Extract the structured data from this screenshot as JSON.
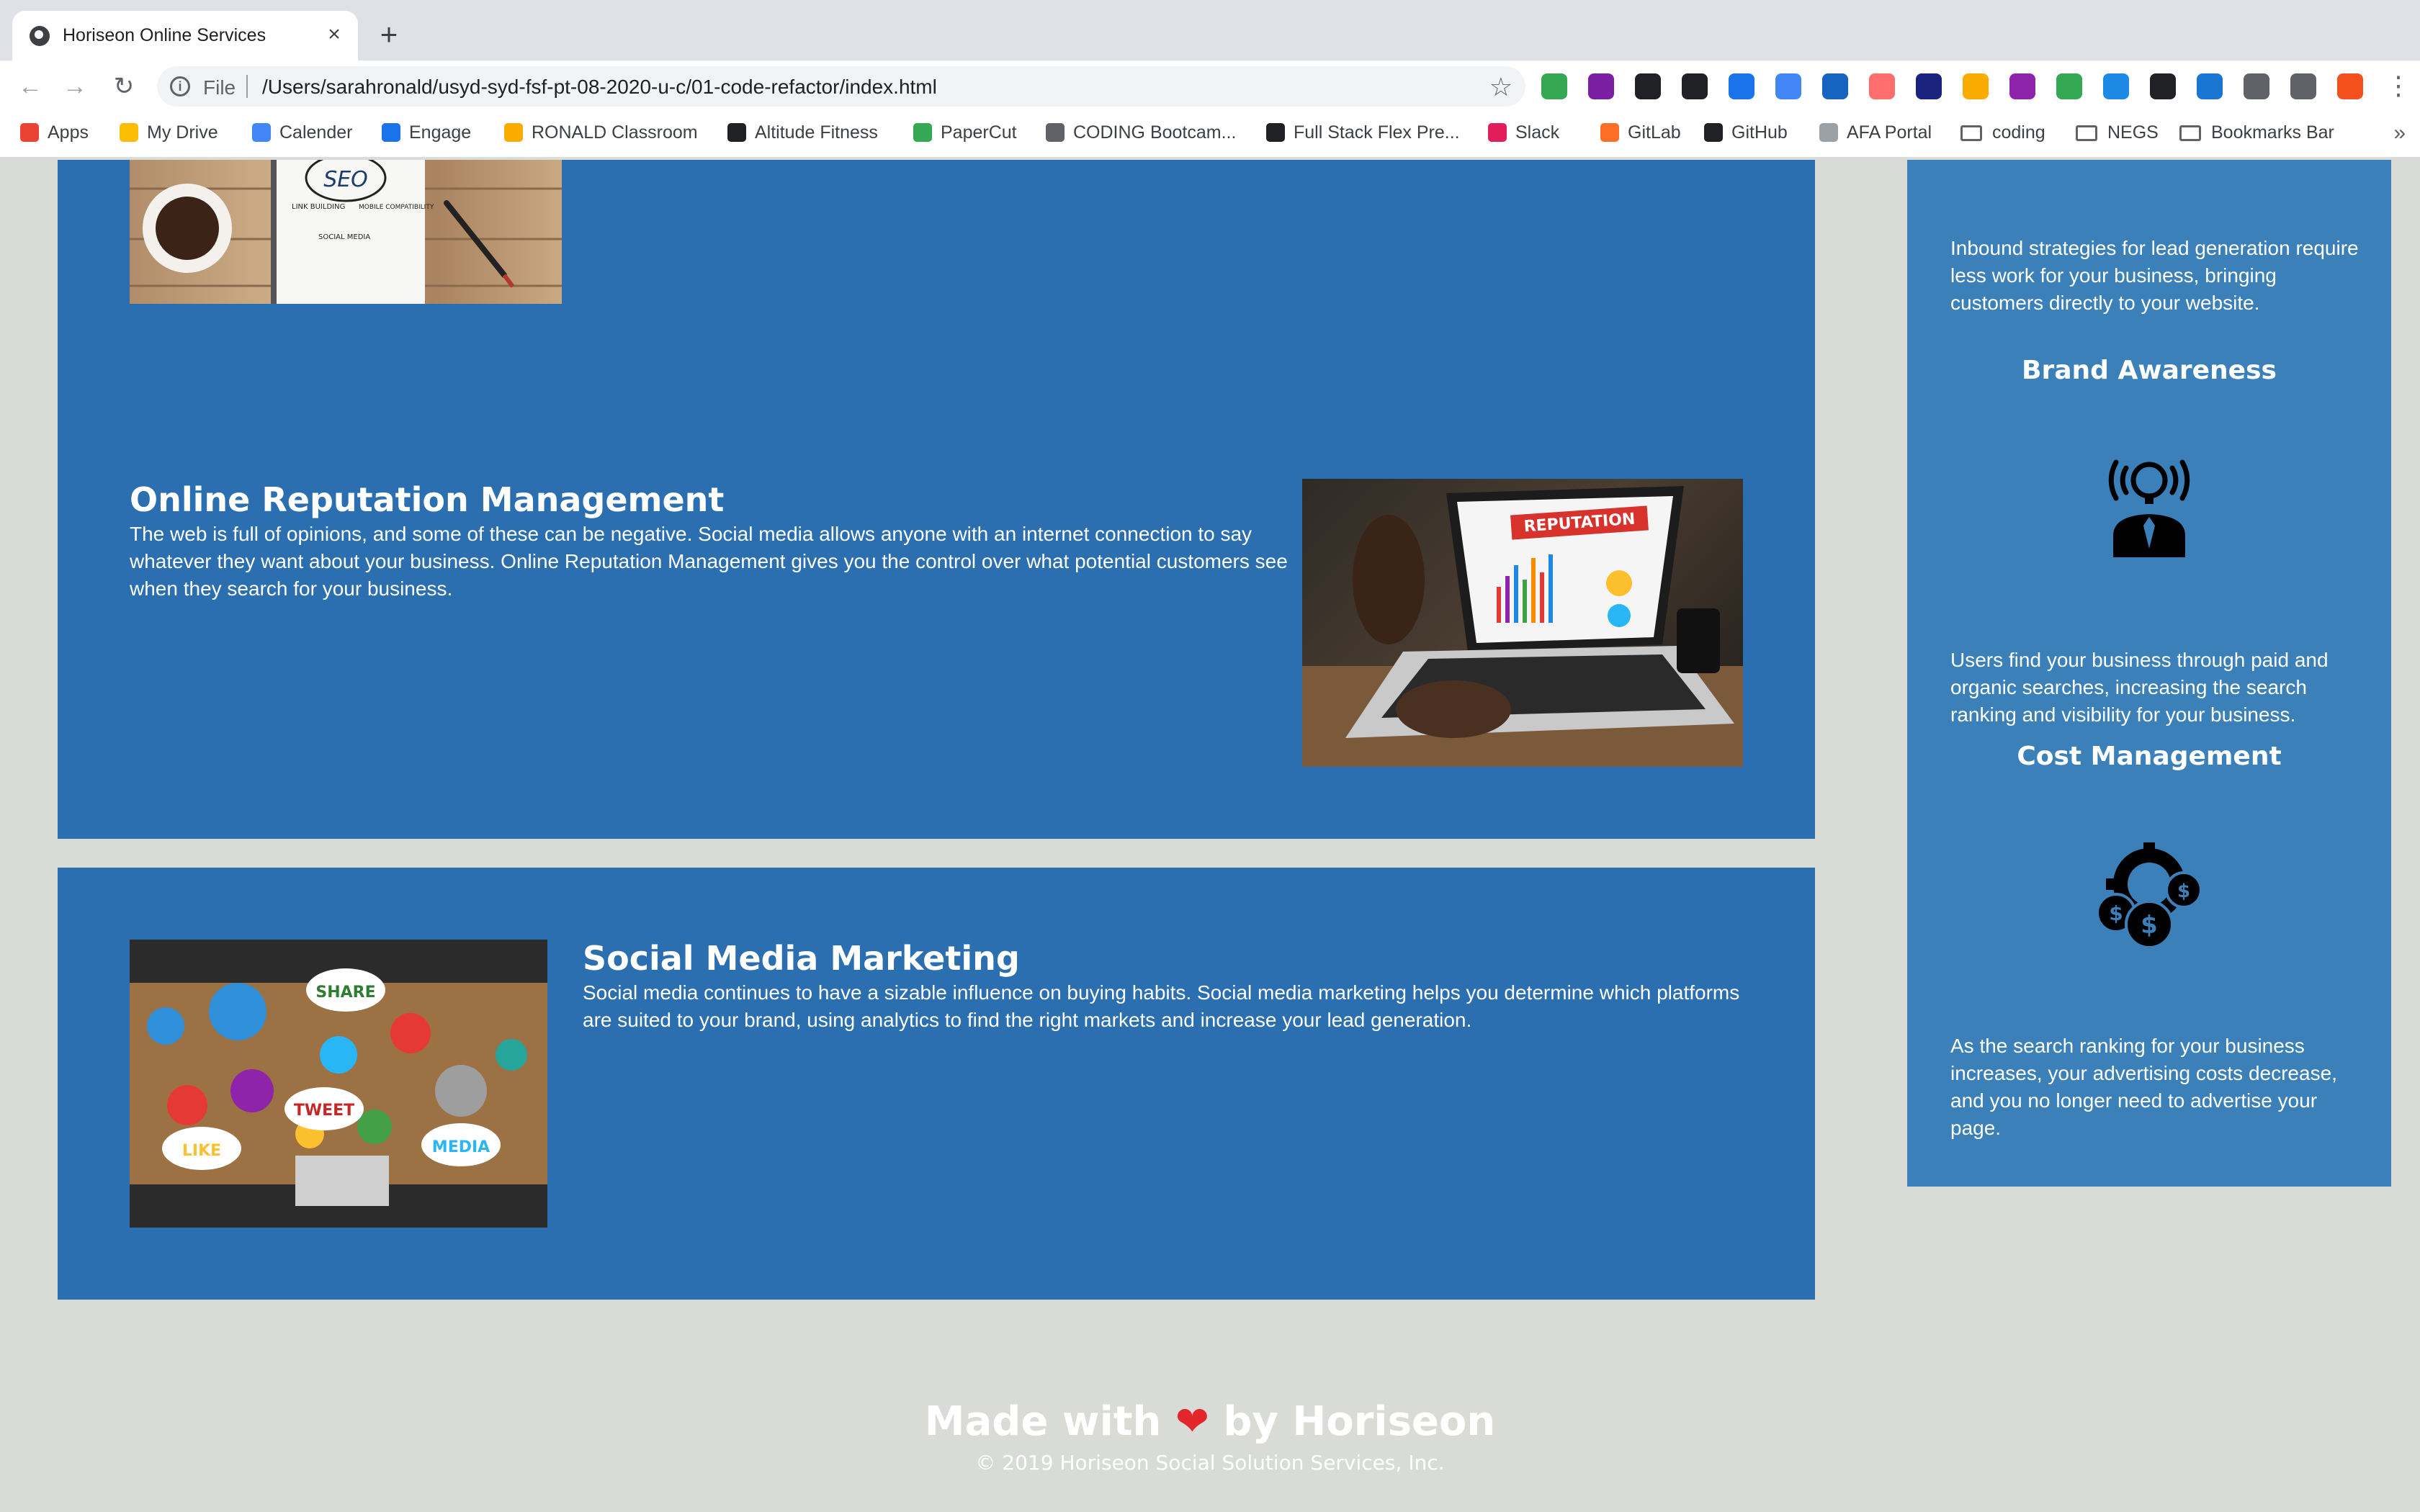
{
  "browser": {
    "tab_title": "Horiseon Online Services",
    "tab_close": "×",
    "new_tab": "+",
    "back": "←",
    "forward": "→",
    "reload": "↻",
    "info_glyph": "i",
    "scheme": "File",
    "url": "/Users/sarahronald/usyd-syd-fsf-pt-08-2020-u-c/01-code-refactor/index.html",
    "star": "☆",
    "menu": "⋮"
  },
  "bookmarks": {
    "items": [
      {
        "label": "Apps",
        "icon": "apps-grid-icon",
        "color": "#ea4335"
      },
      {
        "label": "My Drive",
        "icon": "google-drive-icon",
        "color": "#fbbc04"
      },
      {
        "label": "Calender",
        "icon": "calendar-icon",
        "color": "#4285f4"
      },
      {
        "label": "Engage",
        "icon": "butterfly-icon",
        "color": "#1a73e8"
      },
      {
        "label": "RONALD Classroom",
        "icon": "classroom-icon",
        "color": "#f9ab00"
      },
      {
        "label": "Altitude Fitness",
        "icon": "altitude-icon",
        "color": "#202124"
      },
      {
        "label": "PaperCut",
        "icon": "papercut-icon",
        "color": "#34a853"
      },
      {
        "label": "CODING Bootcam...",
        "icon": "globe-icon",
        "color": "#5f6368"
      },
      {
        "label": "Full Stack Flex Pre...",
        "icon": "book-icon",
        "color": "#202124"
      },
      {
        "label": "Slack",
        "icon": "slack-icon",
        "color": "#e01e5a"
      },
      {
        "label": "GitLab",
        "icon": "gitlab-icon",
        "color": "#fc6d26"
      },
      {
        "label": "GitHub",
        "icon": "github-icon",
        "color": "#202124"
      },
      {
        "label": "AFA Portal",
        "icon": "afa-icon",
        "color": "#9aa0a6"
      },
      {
        "label": "coding",
        "icon": "folder-icon",
        "color": "#5f6368"
      },
      {
        "label": "NEGS",
        "icon": "folder-icon",
        "color": "#5f6368"
      },
      {
        "label": "Bookmarks Bar",
        "icon": "folder-icon",
        "color": "#5f6368"
      }
    ],
    "more": "»"
  },
  "extensions": [
    "#34a853",
    "#7b1fa2",
    "#202124",
    "#202124",
    "#1a73e8",
    "#4285f4",
    "#1565c0",
    "#ff6d6d",
    "#1a237e",
    "#f9ab00",
    "#8e24aa",
    "#34a853",
    "#1e88e5",
    "#202124",
    "#1976d2",
    "#5f6368",
    "#5f6368",
    "#f4511e"
  ],
  "content": {
    "reputation": {
      "heading": "Online Reputation Management",
      "body": "The web is full of opinions, and some of these can be negative. Social media allows anyone with an internet connection to say whatever they want about your business. Online Reputation Management gives you the control over what potential customers see when they search for your business.",
      "image_label": "REPUTATION"
    },
    "social": {
      "heading": "Social Media Marketing",
      "body": "Social media continues to have a sizable influence on buying habits. Social media marketing helps you determine which platforms are suited to your brand, using analytics to find the right markets and increase your lead generation.",
      "bubbles": [
        "SHARE",
        "TWEET",
        "LIKE",
        "MEDIA"
      ]
    },
    "seo_image_text": [
      "SEO",
      "LINK BUILDING",
      "MOBILE COMPATIBILITY",
      "SOCIAL MEDIA"
    ]
  },
  "sidebar": {
    "lead_text": "Inbound strategies for lead generation require less work for your business, bringing customers directly to your website.",
    "brand_heading": "Brand Awareness",
    "brand_text": "Users find your business through paid and organic searches, increasing the search ranking and visibility for your business.",
    "cost_heading": "Cost Management",
    "cost_text": "As the search ranking for your business increases, your advertising costs decrease, and you no longer need to advertise your page."
  },
  "footer": {
    "made_pre": "Made with",
    "heart": "❤",
    "made_post": "by Horiseon",
    "copyright": "© 2019 Horiseon Social Solution Services, Inc."
  }
}
